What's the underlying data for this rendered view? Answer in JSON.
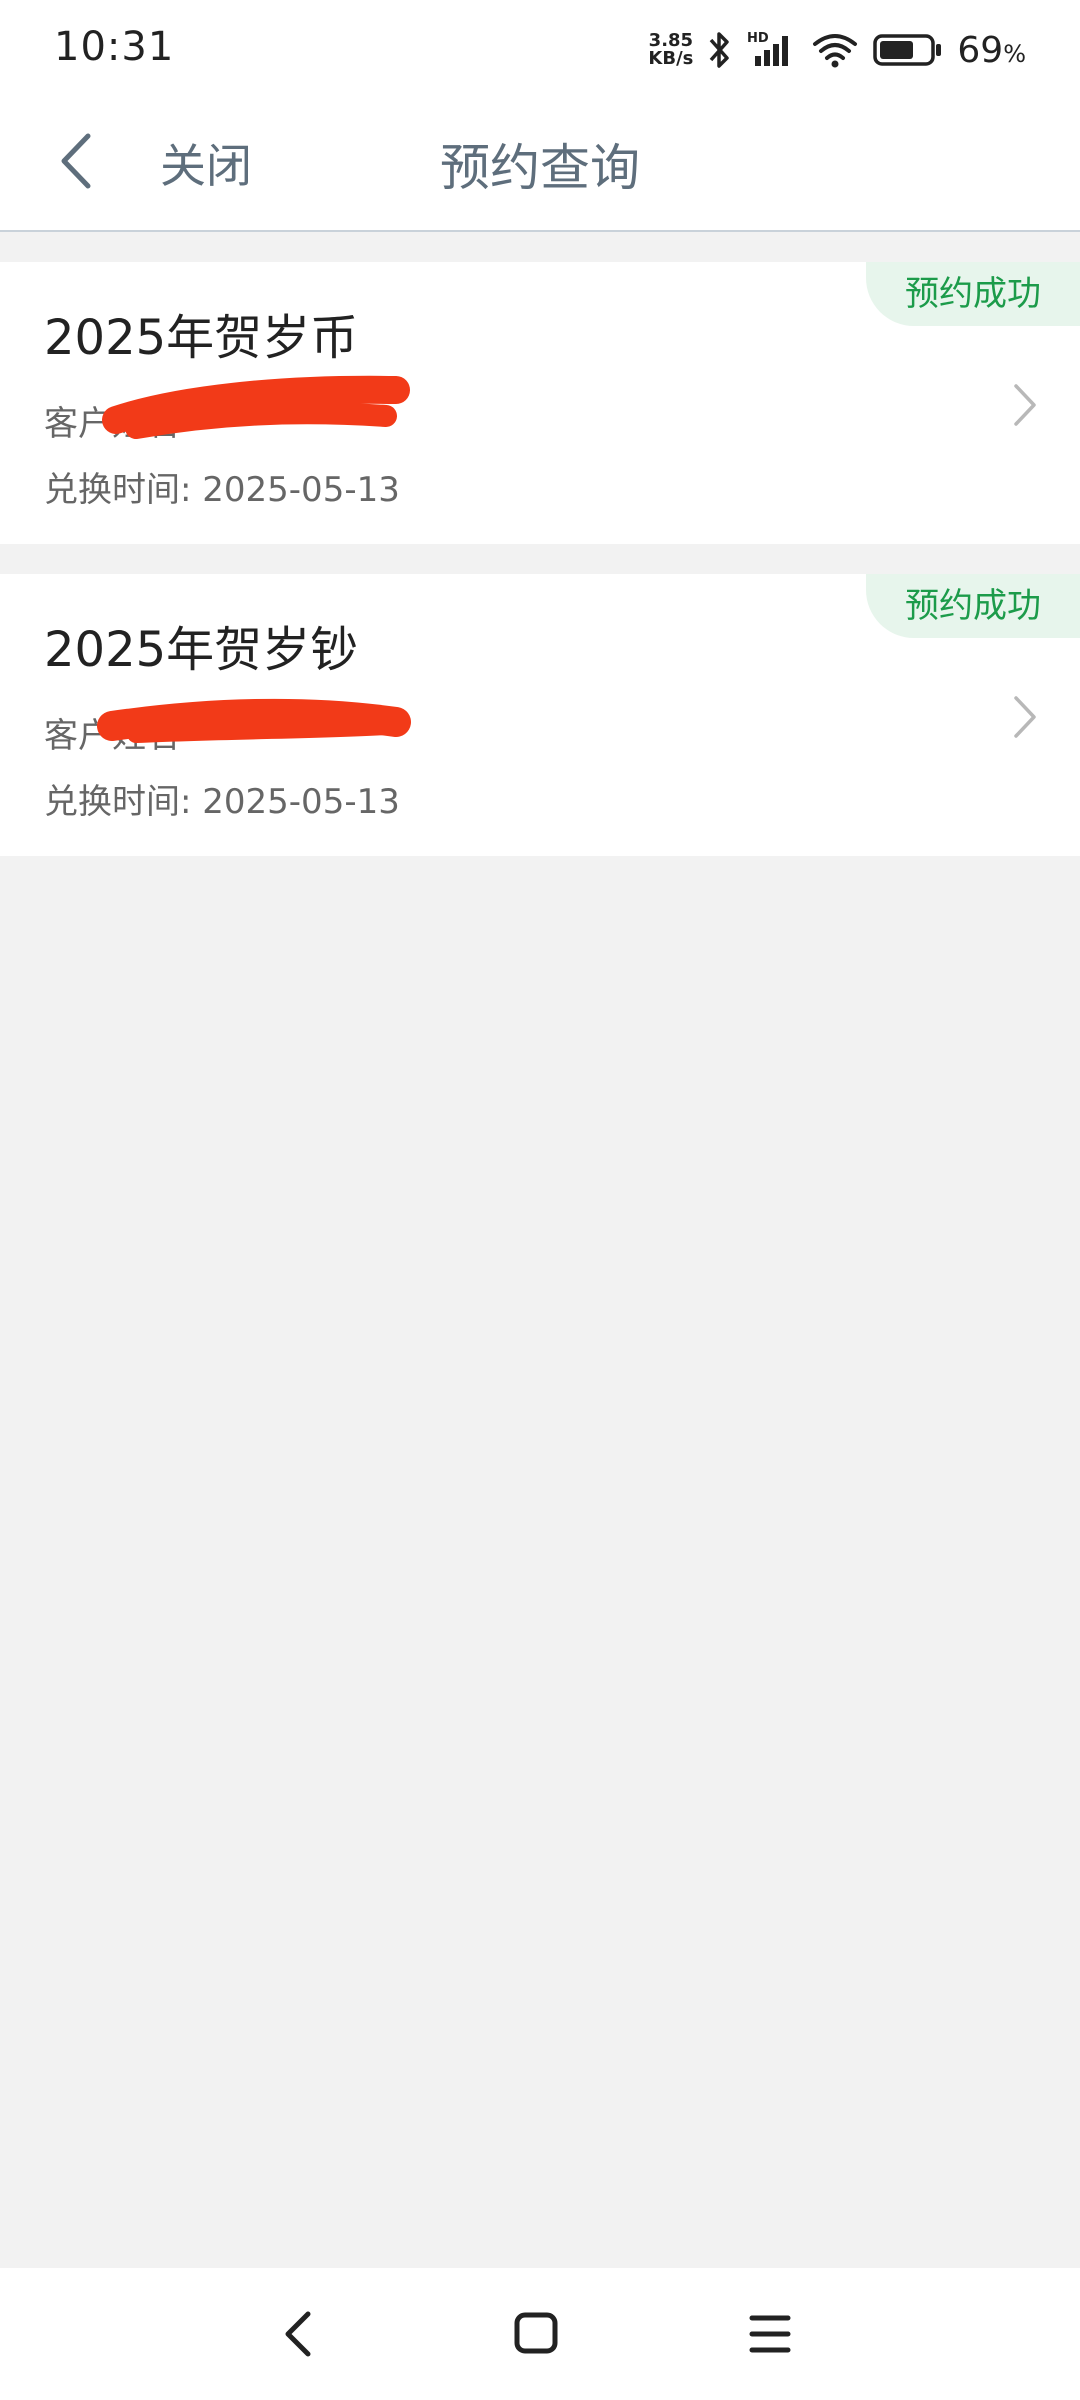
{
  "status_bar": {
    "time": "10:31",
    "net_speed_value": "3.85",
    "net_speed_unit": "KB/s",
    "signal_label": "HD",
    "battery_percent": "69",
    "battery_percent_sign": "%",
    "battery_level": 0.69
  },
  "header": {
    "close_label": "关闭",
    "title": "预约查询"
  },
  "list": {
    "items": [
      {
        "status": "预约成功",
        "title": "2025年贺岁币",
        "customer_label": "客户姓名",
        "exchange_time": "兑换时间: 2025-05-13"
      },
      {
        "status": "预约成功",
        "title": "2025年贺岁钞",
        "customer_label": "客户姓名",
        "exchange_time": "兑换时间: 2025-05-13"
      }
    ]
  },
  "colors": {
    "status_green": "#1c9b4a",
    "status_badge_bg": "#e7f5ec",
    "header_text": "#5e6e7c",
    "redaction": "#f23a18"
  },
  "icons": {
    "back": "chevron-left-icon",
    "item_arrow": "chevron-right-icon",
    "nav_back": "nav-back-icon",
    "nav_home": "nav-home-icon",
    "nav_menu": "nav-menu-icon"
  }
}
